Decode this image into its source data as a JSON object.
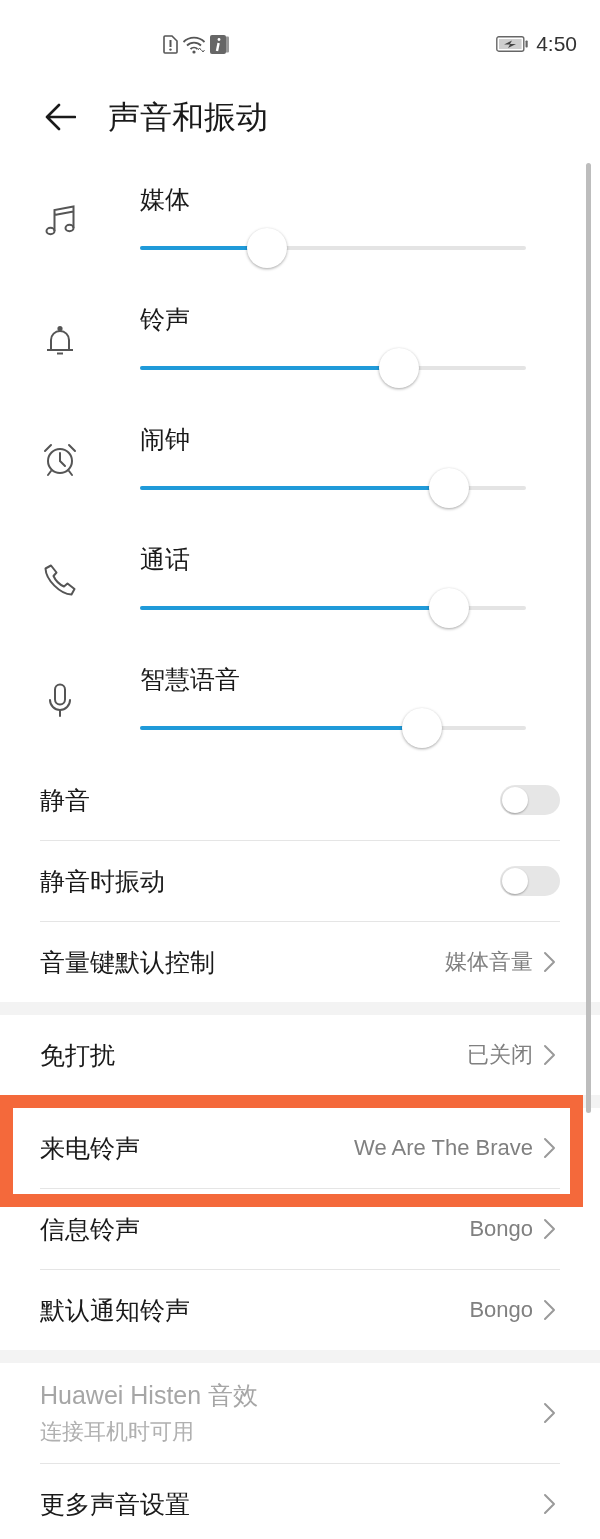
{
  "status_bar": {
    "time": "4:50"
  },
  "header": {
    "title": "声音和振动"
  },
  "volume_sliders": [
    {
      "label": "媒体",
      "level": 0.33
    },
    {
      "label": "铃声",
      "level": 0.67
    },
    {
      "label": "闹钟",
      "level": 0.8
    },
    {
      "label": "通话",
      "level": 0.8
    },
    {
      "label": "智慧语音",
      "level": 0.73
    }
  ],
  "settings_groups": [
    {
      "rows": [
        {
          "kind": "toggle",
          "label": "静音",
          "on": false,
          "disabled": false,
          "highlighted": false
        },
        {
          "kind": "toggle",
          "label": "静音时振动",
          "on": false,
          "disabled": false,
          "highlighted": false
        },
        {
          "kind": "link",
          "label": "音量键默认控制",
          "value": "媒体音量",
          "disabled": false,
          "highlighted": false
        }
      ]
    },
    {
      "rows": [
        {
          "kind": "link",
          "label": "免打扰",
          "value": "已关闭",
          "disabled": false,
          "highlighted": false
        }
      ]
    },
    {
      "rows": [
        {
          "kind": "link",
          "label": "来电铃声",
          "value": "We Are The Brave",
          "disabled": false,
          "highlighted": true
        },
        {
          "kind": "link",
          "label": "信息铃声",
          "value": "Bongo",
          "disabled": false,
          "highlighted": false
        },
        {
          "kind": "link",
          "label": "默认通知铃声",
          "value": "Bongo",
          "disabled": false,
          "highlighted": false
        }
      ]
    },
    {
      "rows": [
        {
          "kind": "link",
          "label": "Huawei Histen 音效",
          "subtitle": "连接耳机时可用",
          "disabled": true,
          "highlighted": false
        },
        {
          "kind": "link",
          "label": "更多声音设置",
          "disabled": false,
          "highlighted": false
        }
      ]
    }
  ]
}
